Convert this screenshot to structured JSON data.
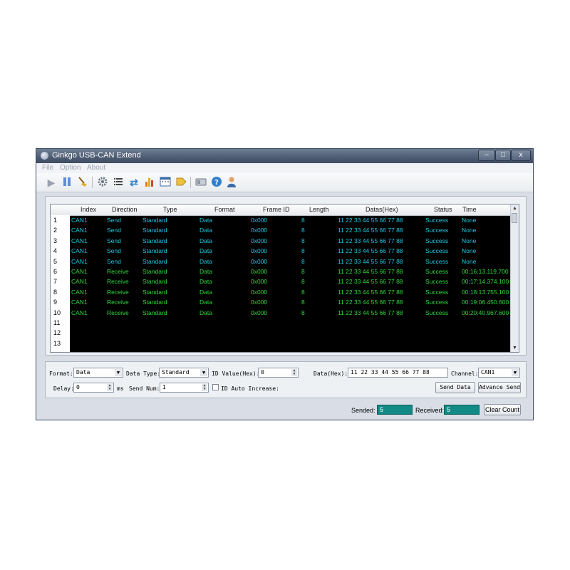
{
  "window": {
    "title": "Ginkgo USB-CAN Extend",
    "min_label": "–",
    "max_label": "□",
    "close_label": "x"
  },
  "menu": [
    {
      "label": "File"
    },
    {
      "label": "Option"
    },
    {
      "label": "About"
    }
  ],
  "toolbar_icons": [
    "play-icon",
    "pause-icon",
    "clear-broom-icon",
    "settings-gear-icon",
    "list-icon",
    "refresh-icon",
    "chart-icon",
    "calendar-icon",
    "tag-icon",
    "card-icon",
    "help-icon",
    "user-icon"
  ],
  "colors": {
    "send_text": "#1ec8e0",
    "receive_text": "#2fd63c",
    "grid_bg": "#000000",
    "status_value_bg": "#128a86"
  },
  "grid": {
    "columns": [
      "Index",
      "Direction",
      "Type",
      "Format",
      "Frame ID",
      "Length",
      "Datas(Hex)",
      "Status",
      "Time"
    ],
    "rows": [
      {
        "num": "1",
        "index": "CAN1",
        "direction": "Send",
        "type": "Standard",
        "format": "Data",
        "frame_id": "0x000",
        "length": "8",
        "data": "11 22 33 44 55 66 77 88",
        "status": "Success",
        "time": "None"
      },
      {
        "num": "2",
        "index": "CAN1",
        "direction": "Send",
        "type": "Standard",
        "format": "Data",
        "frame_id": "0x000",
        "length": "8",
        "data": "11 22 33 44 55 66 77 88",
        "status": "Success",
        "time": "None"
      },
      {
        "num": "3",
        "index": "CAN1",
        "direction": "Send",
        "type": "Standard",
        "format": "Data",
        "frame_id": "0x000",
        "length": "8",
        "data": "11 22 33 44 55 66 77 88",
        "status": "Success",
        "time": "None"
      },
      {
        "num": "4",
        "index": "CAN1",
        "direction": "Send",
        "type": "Standard",
        "format": "Data",
        "frame_id": "0x000",
        "length": "8",
        "data": "11 22 33 44 55 66 77 88",
        "status": "Success",
        "time": "None"
      },
      {
        "num": "5",
        "index": "CAN1",
        "direction": "Send",
        "type": "Standard",
        "format": "Data",
        "frame_id": "0x000",
        "length": "8",
        "data": "11 22 33 44 55 66 77 88",
        "status": "Success",
        "time": "None"
      },
      {
        "num": "6",
        "index": "CAN1",
        "direction": "Receive",
        "type": "Standard",
        "format": "Data",
        "frame_id": "0x000",
        "length": "8",
        "data": "11 22 33 44 55 66 77 88",
        "status": "Success",
        "time": "00:16:13.119.700"
      },
      {
        "num": "7",
        "index": "CAN1",
        "direction": "Receive",
        "type": "Standard",
        "format": "Data",
        "frame_id": "0x000",
        "length": "8",
        "data": "11 22 33 44 55 66 77 88",
        "status": "Success",
        "time": "00:17:14.374.100"
      },
      {
        "num": "8",
        "index": "CAN1",
        "direction": "Receive",
        "type": "Standard",
        "format": "Data",
        "frame_id": "0x000",
        "length": "8",
        "data": "11 22 33 44 55 66 77 88",
        "status": "Success",
        "time": "00:18:13.755.100"
      },
      {
        "num": "9",
        "index": "CAN1",
        "direction": "Receive",
        "type": "Standard",
        "format": "Data",
        "frame_id": "0x000",
        "length": "8",
        "data": "11 22 33 44 55 66 77 88",
        "status": "Success",
        "time": "00:19:06.450.600"
      },
      {
        "num": "10",
        "index": "CAN1",
        "direction": "Receive",
        "type": "Standard",
        "format": "Data",
        "frame_id": "0x000",
        "length": "8",
        "data": "11 22 33 44 55 66 77 88",
        "status": "Success",
        "time": "00:20:40.967.600"
      }
    ],
    "empty_row_numbers": [
      "11",
      "12",
      "13"
    ]
  },
  "controls": {
    "format_label": "Format:",
    "format_value": "Data",
    "data_type_label": "Data Type:",
    "data_type_value": "Standard",
    "id_value_label": "ID Value(Hex):",
    "id_value": "0",
    "data_hex_label": "Data(Hex):",
    "data_hex_value": "11 22 33 44 55 66 77 88",
    "channel_label": "Channel:",
    "channel_value": "CAN1",
    "delay_label": "Delay:",
    "delay_value": "0",
    "delay_unit": "ms",
    "send_num_label": "Send Num:",
    "send_num_value": "1",
    "id_auto_increase_label": "ID Auto Increase:",
    "send_data_button": "Send Data",
    "advance_send_button": "Advance Send"
  },
  "status": {
    "sended_label": "Sended:",
    "sended_value": "5",
    "received_label": "Received:",
    "received_value": "5",
    "clear_count_button": "Clear Count"
  }
}
